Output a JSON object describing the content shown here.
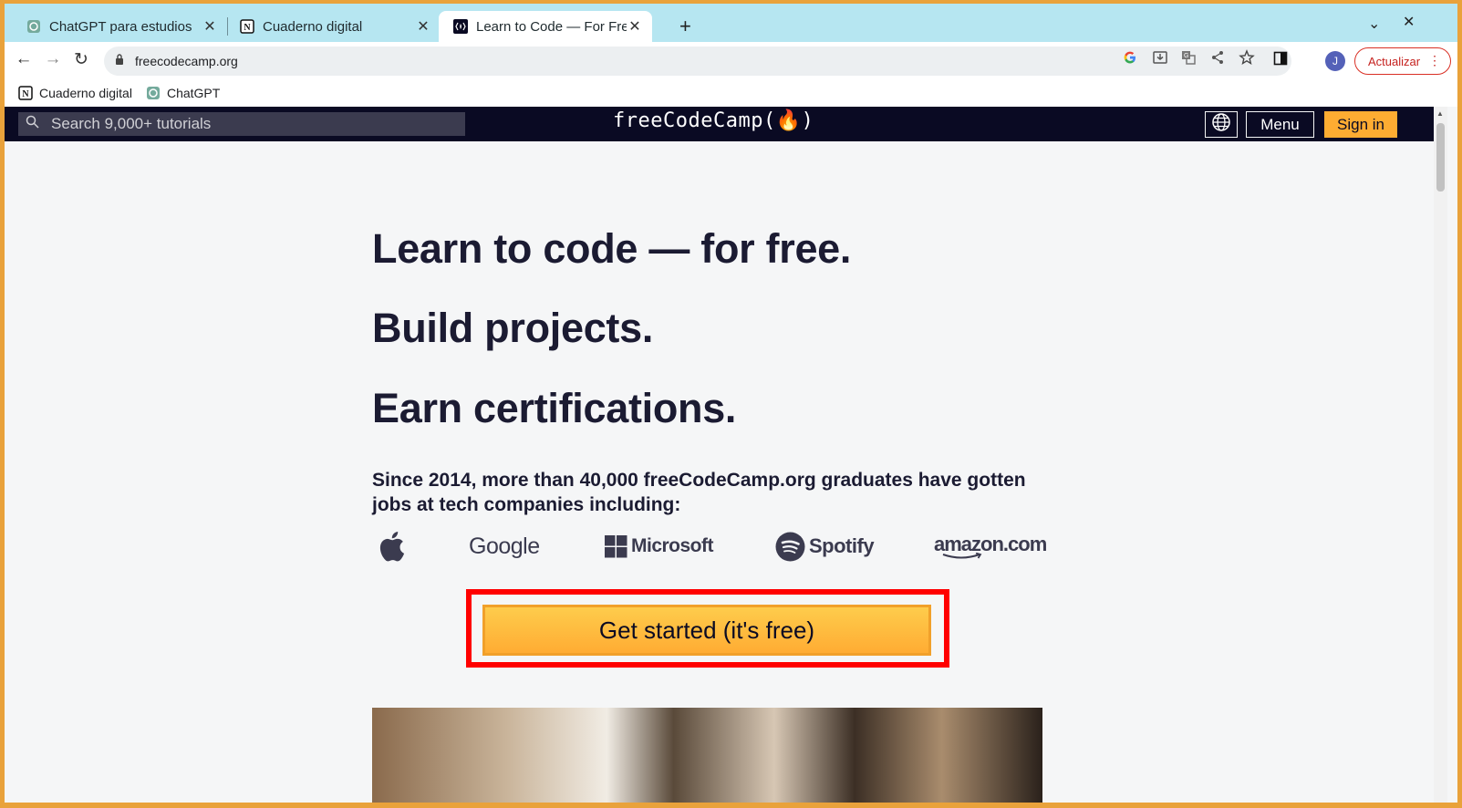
{
  "browser": {
    "tabs": [
      {
        "title": "ChatGPT para estudios",
        "icon": "chatgpt-icon"
      },
      {
        "title": "Cuaderno digital",
        "icon": "notion-icon"
      },
      {
        "title": "Learn to Code — For Free",
        "icon": "freecodecamp-icon"
      }
    ],
    "url": "freecodecamp.org",
    "avatar_initial": "J",
    "update_label": "Actualizar",
    "bookmarks": [
      {
        "label": "Cuaderno digital",
        "icon": "notion-icon"
      },
      {
        "label": "ChatGPT",
        "icon": "chatgpt-icon"
      }
    ]
  },
  "site": {
    "search_placeholder": "Search 9,000+ tutorials",
    "logo_text": "freeCodeCamp(🔥)",
    "menu_label": "Menu",
    "signin_label": "Sign in",
    "headline1": "Learn to code — for free.",
    "headline2": "Build projects.",
    "headline3": "Earn certifications.",
    "since_text": "Since 2014, more than 40,000 freeCodeCamp.org graduates have gotten jobs at tech companies including:",
    "companies": [
      "Google",
      "Microsoft",
      "Spotify",
      "amazon.com"
    ],
    "cta_label": "Get started (it's free)"
  },
  "colors": {
    "nav_bg": "#0a0a23",
    "cta": "#feac32",
    "highlight": "#ff0000"
  }
}
